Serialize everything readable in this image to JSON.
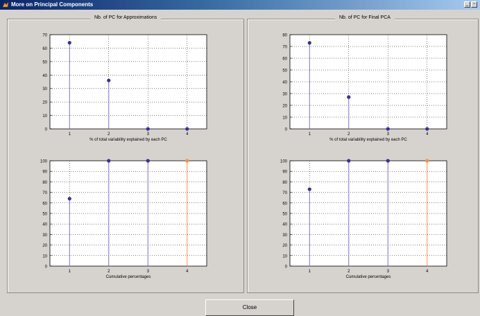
{
  "window": {
    "title": "More on Principal Components",
    "colors": {
      "titlebar": "#0a246a",
      "background": "#d6d3ce"
    }
  },
  "panels": [
    {
      "title": "Nb. of PC for Approximations"
    },
    {
      "title": "Nb. of PC for Final PCA"
    }
  ],
  "close_button": {
    "label": "Close"
  },
  "chart_data": [
    {
      "type": "stem",
      "panel": "Nb. of PC for Approximations",
      "x": [
        1,
        2,
        3,
        4
      ],
      "values": [
        64,
        36,
        0,
        0
      ],
      "xlabel": "% of total variability explained by each PC",
      "ylim": [
        0,
        70
      ],
      "yticks": [
        0,
        10,
        20,
        30,
        40,
        50,
        60,
        70
      ],
      "xticks": [
        1,
        2,
        3,
        4
      ],
      "grid": true,
      "colors": [
        "#7a70c8",
        "#7a70c8",
        "#7a70c8",
        "#7a70c8"
      ]
    },
    {
      "type": "stem",
      "panel": "Nb. of PC for Final PCA",
      "x": [
        1,
        2,
        3,
        4
      ],
      "values": [
        73,
        27,
        0,
        0
      ],
      "xlabel": "% of total variability explained by each PC",
      "ylim": [
        0,
        80
      ],
      "yticks": [
        0,
        10,
        20,
        30,
        40,
        50,
        60,
        70,
        80
      ],
      "xticks": [
        1,
        2,
        3,
        4
      ],
      "grid": true,
      "colors": [
        "#7a70c8",
        "#7a70c8",
        "#7a70c8",
        "#7a70c8"
      ]
    },
    {
      "type": "stem",
      "panel": "Nb. of PC for Approximations",
      "x": [
        1,
        2,
        3,
        4
      ],
      "values": [
        64,
        100,
        100,
        100
      ],
      "xlabel": "Cumulative percentages",
      "ylim": [
        0,
        100
      ],
      "yticks": [
        0,
        10,
        20,
        30,
        40,
        50,
        60,
        70,
        80,
        90,
        100
      ],
      "xticks": [
        1,
        2,
        3,
        4
      ],
      "grid": true,
      "colors": [
        "#7a70c8",
        "#7a70c8",
        "#7a70c8",
        "#ff8c40"
      ]
    },
    {
      "type": "stem",
      "panel": "Nb. of PC for Final PCA",
      "x": [
        1,
        2,
        3,
        4
      ],
      "values": [
        73,
        100,
        100,
        100
      ],
      "xlabel": "Cumulative percentages",
      "ylim": [
        0,
        100
      ],
      "yticks": [
        0,
        10,
        20,
        30,
        40,
        50,
        60,
        70,
        80,
        90,
        100
      ],
      "xticks": [
        1,
        2,
        3,
        4
      ],
      "grid": true,
      "colors": [
        "#7a70c8",
        "#7a70c8",
        "#7a70c8",
        "#ff8c40"
      ]
    }
  ]
}
